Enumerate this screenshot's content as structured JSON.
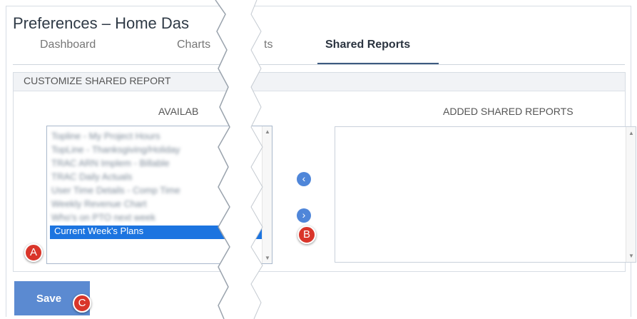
{
  "page": {
    "title": "Preferences – Home Das",
    "tabs": [
      {
        "label": "Dashboard"
      },
      {
        "label": "Charts"
      },
      {
        "label": "ts"
      },
      {
        "label": "Shared Reports",
        "active": true
      }
    ]
  },
  "customize": {
    "header": "CUSTOMIZE SHARED REPORT",
    "available_heading": "AVAILAB",
    "added_heading": "ADDED SHARED REPORTS",
    "available_items": [
      "Topline - My Project Hours",
      "TopLine - Thanksgiving/Holiday",
      "TRAC ARN Implem - Billable",
      "TRAC Daily Actuals",
      "User Time Details - Comp Time",
      "Weekly Revenue Chart",
      "Who's on PTO next week",
      "Current Week's Plans"
    ],
    "selected_index": 7,
    "remove_icon": "chevron-left-icon",
    "add_icon": "chevron-right-icon"
  },
  "callouts": {
    "a": "A",
    "b": "B",
    "c": "C"
  },
  "actions": {
    "save_label": "Save"
  },
  "colors": {
    "accent": "#4f86d9",
    "selected": "#1c74e0",
    "callout": "#d9352a",
    "save": "#5b8ad1"
  }
}
